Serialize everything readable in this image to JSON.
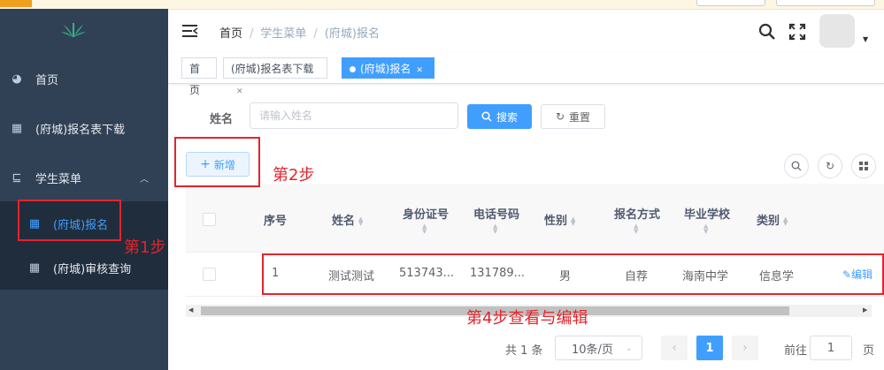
{
  "sidebar": {
    "items": [
      {
        "label": "首页",
        "icon": "dashboard-icon"
      },
      {
        "label": "(府城)报名表下载",
        "icon": "table-icon"
      },
      {
        "label": "学生菜单",
        "icon": "tree-icon"
      },
      {
        "label": "(府城)报名",
        "icon": "grid-icon"
      },
      {
        "label": "(府城)审核查询",
        "icon": "grid-icon"
      }
    ]
  },
  "breadcrumb": {
    "home": "首页",
    "parent": "学生菜单",
    "current": "(府城)报名"
  },
  "tags": [
    {
      "label": "首页"
    },
    {
      "label": "(府城)报名表下载"
    },
    {
      "label": "(府城)报名"
    }
  ],
  "search": {
    "label": "姓名",
    "placeholder": "请输入姓名",
    "search_button": "搜索",
    "reset_button": "重置"
  },
  "toolbar": {
    "add_button": "新增"
  },
  "table": {
    "headers": [
      "序号",
      "姓名",
      "身份证号",
      "电话号码",
      "性别",
      "报名方式",
      "毕业学校",
      "类别"
    ],
    "rows": [
      {
        "index": "1",
        "name": "测试测试",
        "id_number": "513743...",
        "phone": "131789...",
        "gender": "男",
        "method": "自荐",
        "school": "海南中学",
        "category": "信息学",
        "action": "编辑"
      }
    ]
  },
  "pagination": {
    "total": "共 1 条",
    "page_size": "10条/页",
    "current_page": "1",
    "goto_label": "前往",
    "goto_value": "1",
    "page_unit": "页"
  },
  "annotations": {
    "step1": "第1步",
    "step2": "第2步",
    "step4": "第4步查看与编辑"
  },
  "colors": {
    "sidebar_bg": "#304156",
    "primary": "#409eff",
    "annotation_red": "#e4242b"
  }
}
